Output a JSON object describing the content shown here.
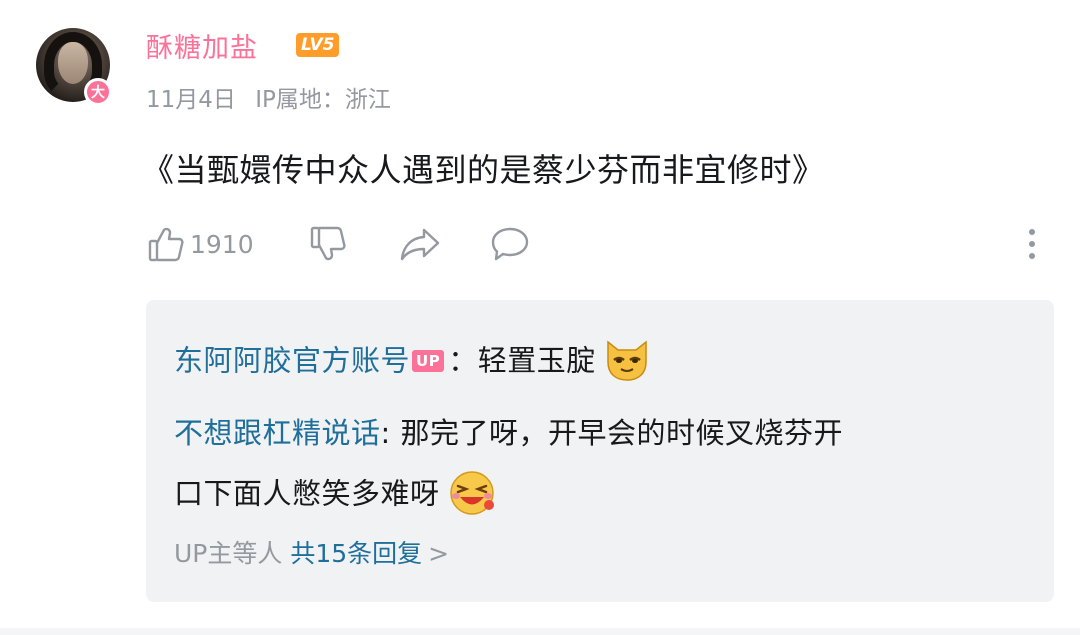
{
  "comment": {
    "username": "酥糖加盐",
    "level": "LV5",
    "avatar_badge": "大",
    "date": "11月4日",
    "ip_location": "IP属地：浙江",
    "text": "《当甄嬛传中众人遇到的是蔡少芬而非宜修时》",
    "like_count": "1910"
  },
  "replies": [
    {
      "user": "东阿阿胶官方账号",
      "badge": "UP",
      "text": "：轻置玉腚",
      "emoji": "cat-emoji"
    },
    {
      "user": "不想跟杠精说话",
      "text_line1": ": 那完了呀，开早会的时候叉烧芬开",
      "text_line2": "口下面人憋笑多难呀",
      "emoji": "laughing-emoji"
    }
  ],
  "reply_footer": {
    "prefix": "UP主等人",
    "count_text": "共15条回复",
    "chevron": ">"
  },
  "icons": {
    "like": "thumbs-up-icon",
    "dislike": "thumbs-down-icon",
    "share": "share-icon",
    "reply": "comment-icon",
    "more": "more-vertical-icon"
  },
  "colors": {
    "username": "#fb7299",
    "reply_user": "#1f6f9a",
    "muted": "#9499a0",
    "level_badge": "#ff9d2a",
    "reply_bg": "#f1f2f4"
  }
}
